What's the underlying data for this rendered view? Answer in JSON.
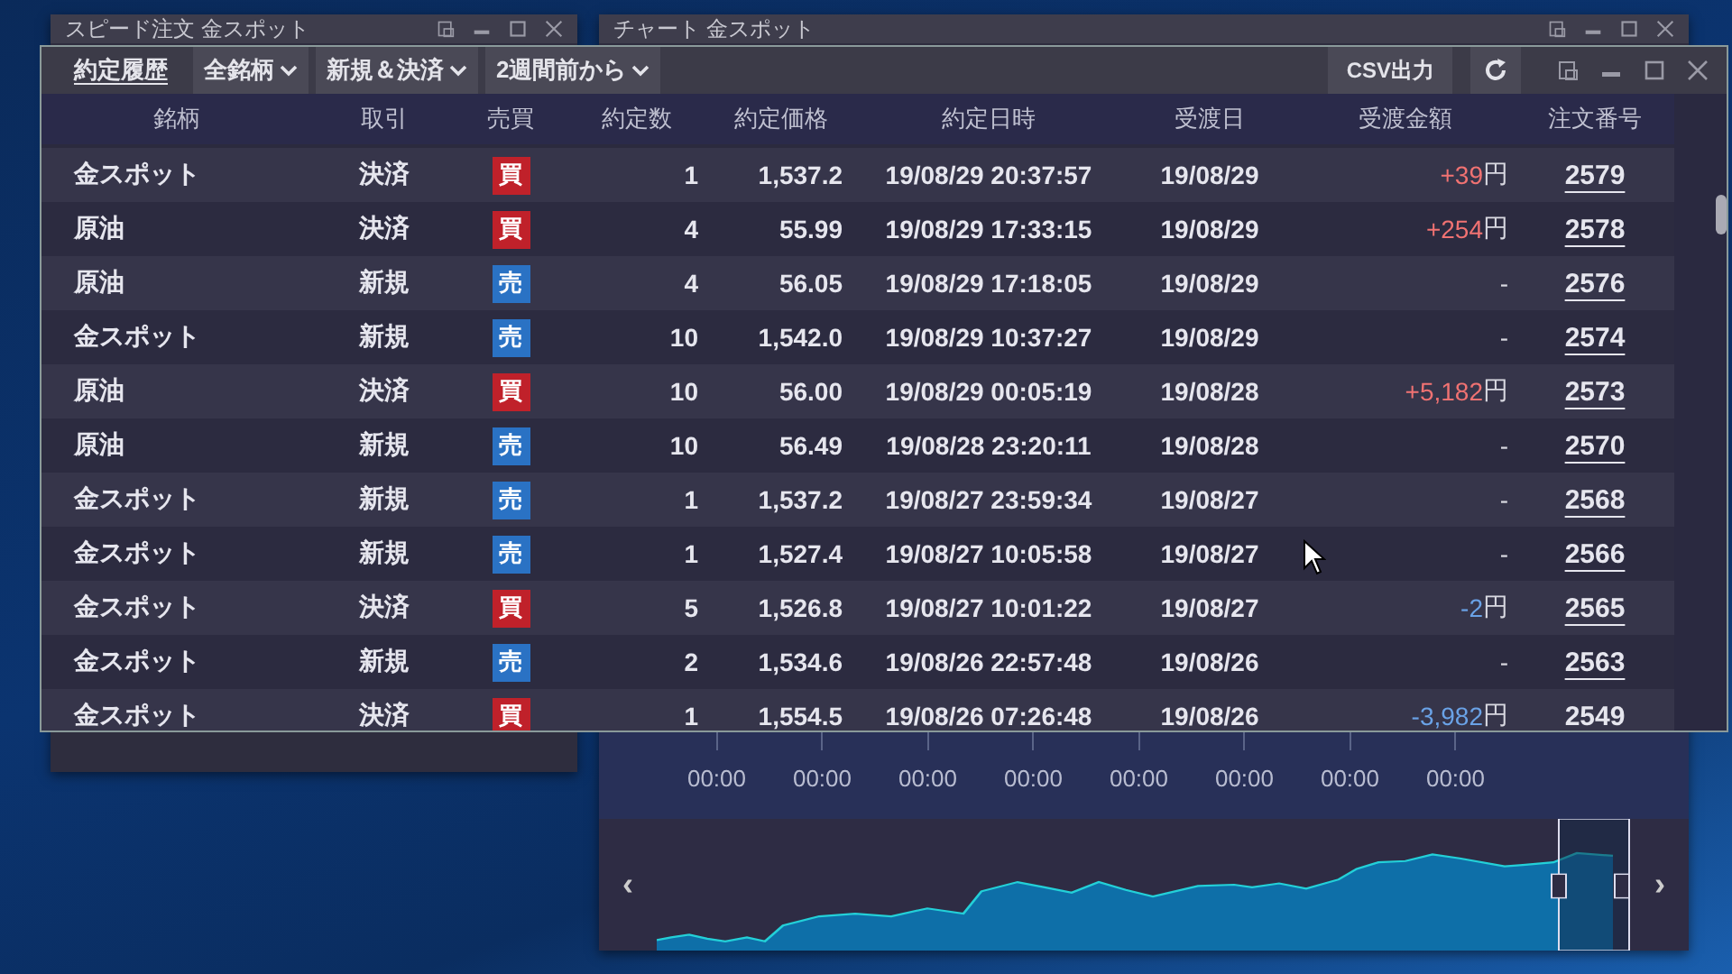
{
  "back_windows": [
    {
      "title": "スピード注文 金スポット"
    },
    {
      "title": "チャート 金スポット"
    }
  ],
  "window": {
    "tabs": [
      {
        "label": "約定履歴",
        "kind": "tab"
      },
      {
        "label": "全銘柄",
        "kind": "dropdown"
      },
      {
        "label": "新規＆決済",
        "kind": "dropdown"
      },
      {
        "label": "2週間前から",
        "kind": "dropdown"
      }
    ],
    "csv_button": "CSV出力"
  },
  "table": {
    "columns": [
      "銘柄",
      "取引",
      "売買",
      "約定数",
      "約定価格",
      "約定日時",
      "受渡日",
      "受渡金額",
      "注文番号"
    ],
    "rows": [
      {
        "symbol": "金スポット",
        "trade": "決済",
        "side": {
          "label": "買",
          "kind": "buy"
        },
        "qty": "1",
        "price": "1,537.2",
        "exec_time": "19/08/29 20:37:57",
        "settle_date": "19/08/29",
        "amount": {
          "value": "+39",
          "unit": "円",
          "kind": "profit"
        },
        "order_no": "2579"
      },
      {
        "symbol": "原油",
        "trade": "決済",
        "side": {
          "label": "買",
          "kind": "buy"
        },
        "qty": "4",
        "price": "55.99",
        "exec_time": "19/08/29 17:33:15",
        "settle_date": "19/08/29",
        "amount": {
          "value": "+254",
          "unit": "円",
          "kind": "profit"
        },
        "order_no": "2578"
      },
      {
        "symbol": "原油",
        "trade": "新規",
        "side": {
          "label": "売",
          "kind": "sell"
        },
        "qty": "4",
        "price": "56.05",
        "exec_time": "19/08/29 17:18:05",
        "settle_date": "19/08/29",
        "amount": {
          "value": "-",
          "kind": "none"
        },
        "order_no": "2576"
      },
      {
        "symbol": "金スポット",
        "trade": "新規",
        "side": {
          "label": "売",
          "kind": "sell"
        },
        "qty": "10",
        "price": "1,542.0",
        "exec_time": "19/08/29 10:37:27",
        "settle_date": "19/08/29",
        "amount": {
          "value": "-",
          "kind": "none"
        },
        "order_no": "2574"
      },
      {
        "symbol": "原油",
        "trade": "決済",
        "side": {
          "label": "買",
          "kind": "buy"
        },
        "qty": "10",
        "price": "56.00",
        "exec_time": "19/08/29 00:05:19",
        "settle_date": "19/08/28",
        "amount": {
          "value": "+5,182",
          "unit": "円",
          "kind": "profit"
        },
        "order_no": "2573"
      },
      {
        "symbol": "原油",
        "trade": "新規",
        "side": {
          "label": "売",
          "kind": "sell"
        },
        "qty": "10",
        "price": "56.49",
        "exec_time": "19/08/28 23:20:11",
        "settle_date": "19/08/28",
        "amount": {
          "value": "-",
          "kind": "none"
        },
        "order_no": "2570"
      },
      {
        "symbol": "金スポット",
        "trade": "新規",
        "side": {
          "label": "売",
          "kind": "sell"
        },
        "qty": "1",
        "price": "1,537.2",
        "exec_time": "19/08/27 23:59:34",
        "settle_date": "19/08/27",
        "amount": {
          "value": "-",
          "kind": "none"
        },
        "order_no": "2568"
      },
      {
        "symbol": "金スポット",
        "trade": "新規",
        "side": {
          "label": "売",
          "kind": "sell"
        },
        "qty": "1",
        "price": "1,527.4",
        "exec_time": "19/08/27 10:05:58",
        "settle_date": "19/08/27",
        "amount": {
          "value": "-",
          "kind": "none"
        },
        "order_no": "2566"
      },
      {
        "symbol": "金スポット",
        "trade": "決済",
        "side": {
          "label": "買",
          "kind": "buy"
        },
        "qty": "5",
        "price": "1,526.8",
        "exec_time": "19/08/27 10:01:22",
        "settle_date": "19/08/27",
        "amount": {
          "value": "-2",
          "unit": "円",
          "kind": "loss"
        },
        "order_no": "2565"
      },
      {
        "symbol": "金スポット",
        "trade": "新規",
        "side": {
          "label": "売",
          "kind": "sell"
        },
        "qty": "2",
        "price": "1,534.6",
        "exec_time": "19/08/26 22:57:48",
        "settle_date": "19/08/26",
        "amount": {
          "value": "-",
          "kind": "none"
        },
        "order_no": "2563"
      },
      {
        "symbol": "金スポット",
        "trade": "決済",
        "side": {
          "label": "買",
          "kind": "buy"
        },
        "qty": "1",
        "price": "1,554.5",
        "exec_time": "19/08/26 07:26:48",
        "settle_date": "19/08/26",
        "amount": {
          "value": "-3,982",
          "unit": "円",
          "kind": "loss"
        },
        "order_no": "2549"
      }
    ]
  },
  "chart": {
    "x_axis_labels": [
      "00:00",
      "00:00",
      "00:00",
      "00:00",
      "00:00",
      "00:00",
      "00:00",
      "00:00"
    ],
    "navigator": {
      "left_arrow": "‹",
      "right_arrow": "›"
    }
  }
}
